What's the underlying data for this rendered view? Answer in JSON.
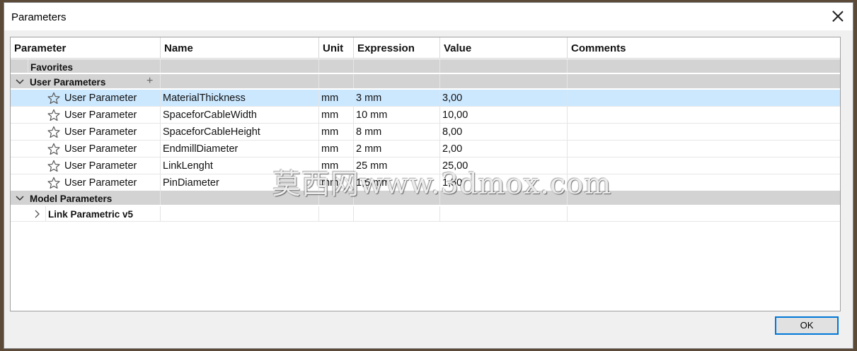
{
  "window": {
    "title": "Parameters",
    "ok_label": "OK"
  },
  "columns": [
    "Parameter",
    "Name",
    "Unit",
    "Expression",
    "Value",
    "Comments"
  ],
  "groups": {
    "favorites": "Favorites",
    "user": "User Parameters",
    "model": "Model Parameters",
    "model_child": "Link Parametric v5"
  },
  "params": [
    {
      "type": "User Parameter",
      "name": "MaterialThickness",
      "unit": "mm",
      "expression": "3 mm",
      "value": "3,00",
      "comment": ""
    },
    {
      "type": "User Parameter",
      "name": "SpaceforCableWidth",
      "unit": "mm",
      "expression": "10 mm",
      "value": "10,00",
      "comment": ""
    },
    {
      "type": "User Parameter",
      "name": "SpaceforCableHeight",
      "unit": "mm",
      "expression": "8 mm",
      "value": "8,00",
      "comment": ""
    },
    {
      "type": "User Parameter",
      "name": "EndmillDiameter",
      "unit": "mm",
      "expression": "2 mm",
      "value": "2,00",
      "comment": ""
    },
    {
      "type": "User Parameter",
      "name": "LinkLenght",
      "unit": "mm",
      "expression": "25 mm",
      "value": "25,00",
      "comment": ""
    },
    {
      "type": "User Parameter",
      "name": "PinDiameter",
      "unit": "mm",
      "expression": "1,5 mm",
      "value": "1,50",
      "comment": ""
    }
  ],
  "watermark": "莫西网www.3dmox.com",
  "icons": {
    "close": "close-icon",
    "star": "star-outline-icon",
    "collapse": "chevron-down-icon",
    "expand": "chevron-right-icon",
    "add": "plus-icon"
  },
  "colors": {
    "selection": "#cce8ff",
    "group_bg": "#d3d3d3",
    "ok_border": "#0078d7"
  }
}
